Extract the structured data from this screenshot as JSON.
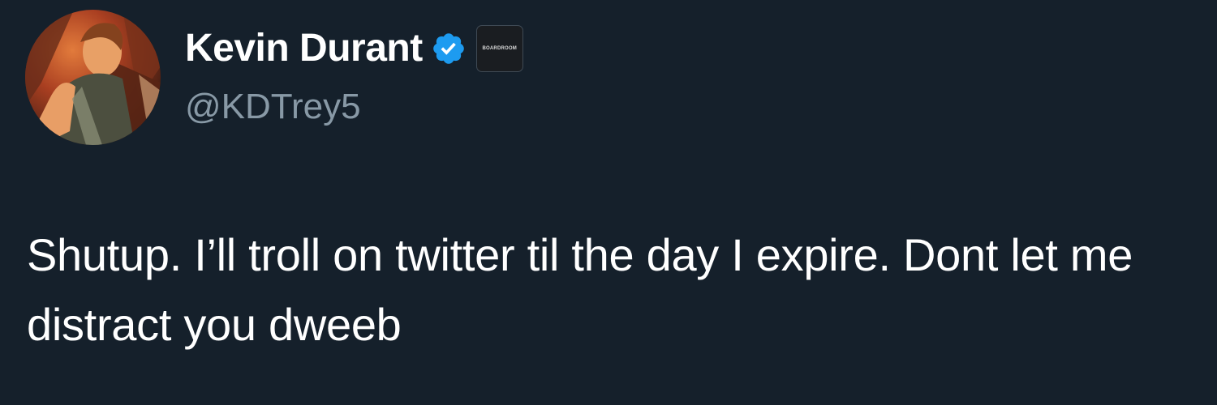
{
  "author": {
    "display_name": "Kevin Durant",
    "handle": "@KDTrey5",
    "avatar_icon": "profile-avatar",
    "verified_icon": "verified-badge-icon",
    "verified_color": "#1d9bf0",
    "affiliate_label": "BOARDROOM"
  },
  "tweet": {
    "text": "Shutup. I’ll troll on twitter til the day I expire. Dont let me distract you dweeb"
  },
  "colors": {
    "background": "#15202b",
    "primary_text": "#ffffff",
    "secondary_text": "#8899a6"
  }
}
